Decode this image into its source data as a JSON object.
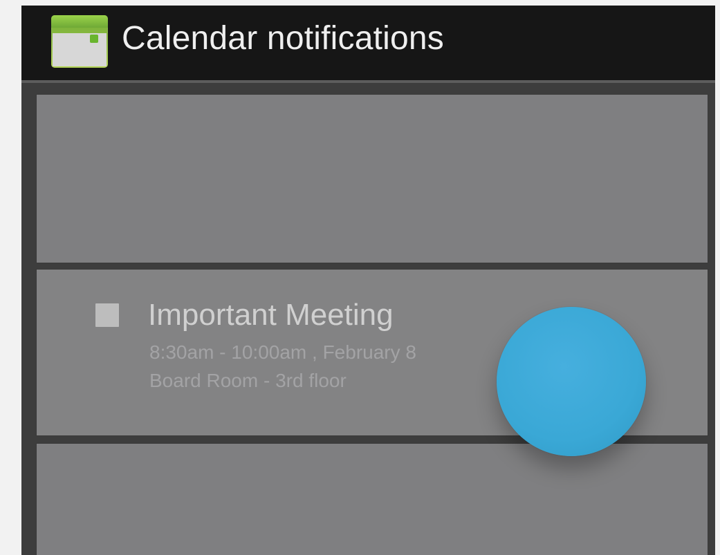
{
  "app": {
    "title": "Calendar notifications",
    "icon": "calendar-icon"
  },
  "notification": {
    "title": "Important Meeting",
    "time": "8:30am - 10:00am , February 8",
    "location": "Board Room - 3rd floor"
  },
  "colors": {
    "header": "#161616",
    "card": "#7f7f81",
    "background": "#3d3d3d",
    "accent": "#3aa8d6"
  }
}
